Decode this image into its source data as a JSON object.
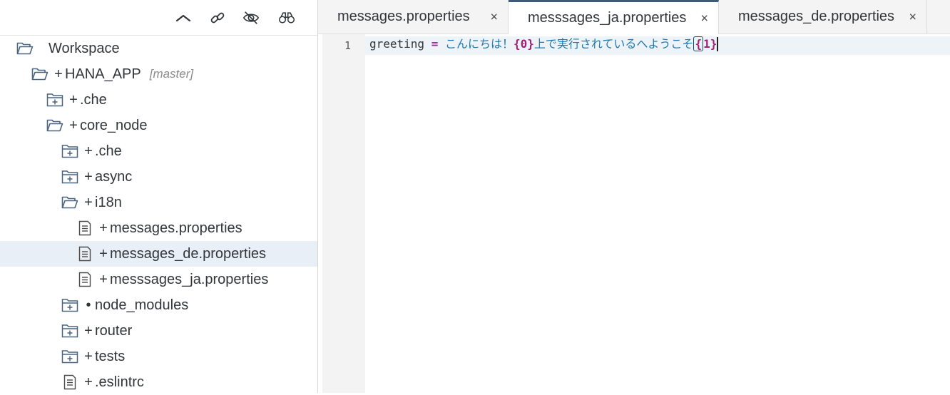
{
  "explorer": {
    "toolbar": {
      "icons": [
        "collapse-icon",
        "link-icon",
        "hide-icon",
        "binoculars-icon"
      ]
    },
    "tree": [
      {
        "label": "Workspace",
        "git": "",
        "branch": "",
        "icon": "folder-open-icon",
        "indent": 0
      },
      {
        "label": "HANA_APP",
        "git": "+",
        "branch": "[master]",
        "icon": "folder-open-icon",
        "indent": 1
      },
      {
        "label": ".che",
        "git": "+",
        "branch": "",
        "icon": "folder-closed-icon",
        "indent": 2
      },
      {
        "label": "core_node",
        "git": "+",
        "branch": "",
        "icon": "folder-open-icon",
        "indent": 2
      },
      {
        "label": ".che",
        "git": "+",
        "branch": "",
        "icon": "folder-closed-icon",
        "indent": 3
      },
      {
        "label": "async",
        "git": "+",
        "branch": "",
        "icon": "folder-closed-icon",
        "indent": 3
      },
      {
        "label": "i18n",
        "git": "+",
        "branch": "",
        "icon": "folder-open-icon",
        "indent": 3
      },
      {
        "label": "messages.properties",
        "git": "+",
        "branch": "",
        "icon": "file-icon",
        "indent": 4
      },
      {
        "label": "messages_de.properties",
        "git": "+",
        "branch": "",
        "icon": "file-icon",
        "indent": 4,
        "selected": true
      },
      {
        "label": "messsages_ja.properties",
        "git": "+",
        "branch": "",
        "icon": "file-icon",
        "indent": 4
      },
      {
        "label": "node_modules",
        "git": "•",
        "branch": "",
        "icon": "folder-closed-icon",
        "indent": 3
      },
      {
        "label": "router",
        "git": "+",
        "branch": "",
        "icon": "folder-closed-icon",
        "indent": 3
      },
      {
        "label": "tests",
        "git": "+",
        "branch": "",
        "icon": "folder-closed-icon",
        "indent": 3
      },
      {
        "label": ".eslintrc",
        "git": "+",
        "branch": "",
        "icon": "file-icon",
        "indent": 3
      }
    ]
  },
  "editor": {
    "tabs": [
      {
        "label": "messages.properties",
        "close": "×",
        "active": false
      },
      {
        "label": "messsages_ja.properties",
        "close": "×",
        "active": true
      },
      {
        "label": "messages_de.properties",
        "close": "×",
        "active": false
      }
    ],
    "line_number": "1",
    "code": {
      "key": "greeting",
      "eq": "=",
      "text1": "こんにちは！",
      "ph0": "{0}",
      "text2": "上で実行されているへようこそ",
      "brace_open": "{",
      "ph1_rest": "1}"
    }
  },
  "colors": {
    "accent": "#3f5a7a",
    "selected_row": "#e8eff6",
    "icon": "#4a6380"
  }
}
